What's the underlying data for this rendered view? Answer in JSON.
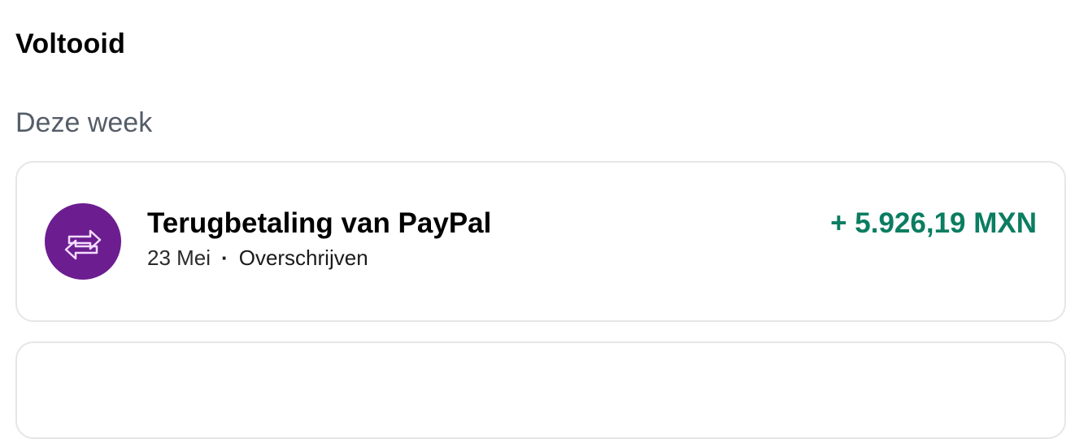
{
  "section": {
    "title": "Voltooid"
  },
  "groups": [
    {
      "title": "Deze week",
      "transactions": [
        {
          "title": "Terugbetaling van PayPal",
          "date": "23 Mei",
          "separator": "·",
          "type": "Overschrijven",
          "amount": "+ 5.926,19 MXN",
          "icon": "transfer-arrows-icon"
        }
      ]
    }
  ],
  "colors": {
    "icon_bg": "#6c1d90",
    "positive_amount": "#0b7d61",
    "card_border": "#e6e6e6",
    "secondary_text": "#545d68"
  }
}
